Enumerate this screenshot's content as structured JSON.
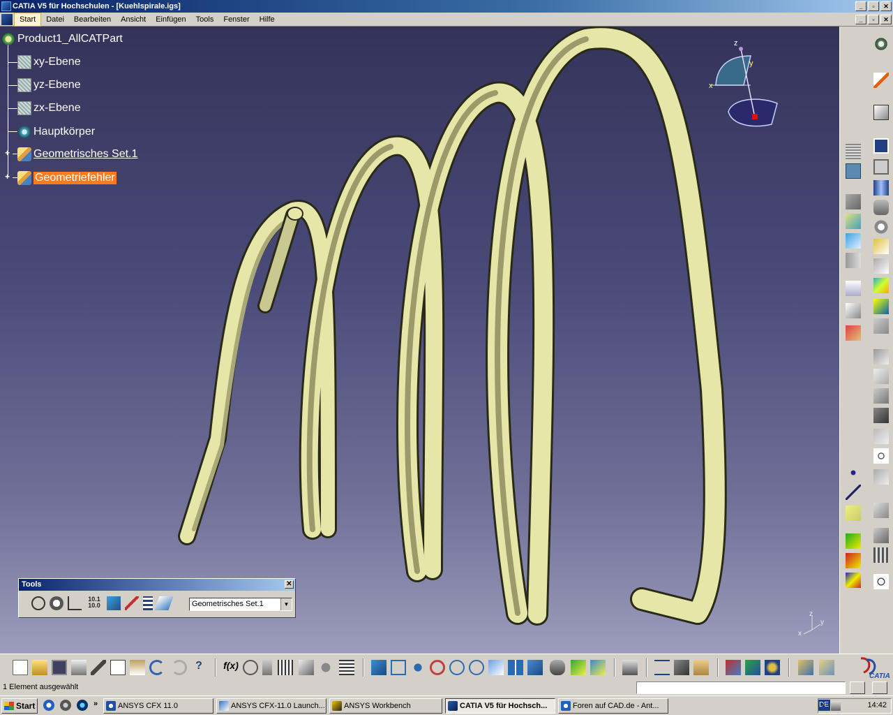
{
  "window": {
    "title": "CATIA V5 für Hochschulen - [Kuehlspirale.igs]",
    "controls": [
      "_",
      "▫",
      "✕"
    ]
  },
  "menu": {
    "items": [
      "Start",
      "Datei",
      "Bearbeiten",
      "Ansicht",
      "Einfügen",
      "Tools",
      "Fenster",
      "Hilfe"
    ],
    "active": "Start"
  },
  "tree": {
    "root": "Product1_AllCATPart",
    "nodes": [
      {
        "label": "xy-Ebene",
        "icon": "plane-icon"
      },
      {
        "label": "yz-Ebene",
        "icon": "plane-icon"
      },
      {
        "label": "zx-Ebene",
        "icon": "plane-icon"
      },
      {
        "label": "Hauptkörper",
        "icon": "body-icon"
      },
      {
        "label": "Geometrisches Set.1",
        "icon": "geometric-set-icon",
        "underlined": true
      },
      {
        "label": "Geometriefehler",
        "icon": "geometric-set-icon",
        "selected": true
      }
    ]
  },
  "compass": {
    "x": "x",
    "y": "y",
    "z": "z"
  },
  "axis_indicator": {
    "x": "x",
    "y": "y",
    "z": "z"
  },
  "tools_panel": {
    "title": "Tools",
    "close": "✕",
    "select_value": "Geometrisches Set.1",
    "snap_label_top": "10.1",
    "snap_label_bottom": "10.0"
  },
  "status": {
    "text": "1 Element ausgewählt"
  },
  "taskbar": {
    "start": "Start",
    "tasks": [
      {
        "label": "ANSYS CFX 11.0",
        "active": false
      },
      {
        "label": "ANSYS CFX-11.0 Launch...",
        "active": false
      },
      {
        "label": "ANSYS Workbench",
        "active": false
      },
      {
        "label": "CATIA V5 für Hochsch...",
        "active": true
      },
      {
        "label": "Foren auf CAD.de - Ant...",
        "active": false
      }
    ],
    "quicklaunch_more": "»",
    "language": "DE",
    "tray_more": "«",
    "clock": "14:42"
  },
  "logo": "CATIA",
  "colors": {
    "viewport_top": "#33335a",
    "viewport_bottom": "#9c9cbc",
    "spiral_fill": "#e6e6a8",
    "selection": "#ff7b1c",
    "titlebar": "#0a246a"
  }
}
